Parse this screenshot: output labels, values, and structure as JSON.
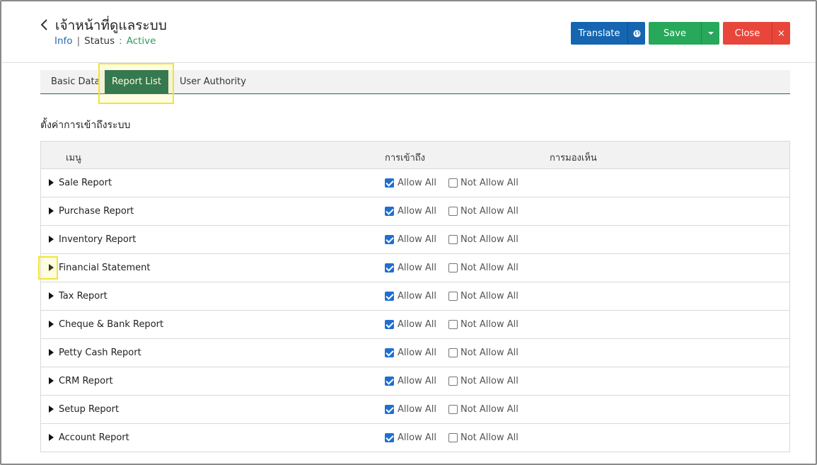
{
  "header": {
    "title": "เจ้าหน้าที่ดูแลระบบ",
    "info_label": "Info",
    "separator": "|",
    "status_label": "Status",
    "colon": ":",
    "status_value": "Active"
  },
  "toolbar": {
    "translate_label": "Translate",
    "save_label": "Save",
    "close_label": "Close",
    "close_x": "×",
    "globe_icon": "globe-icon",
    "caret_icon": "chevron-down-icon"
  },
  "tabs": [
    {
      "label": "Basic Data",
      "active": false
    },
    {
      "label": "Report List",
      "active": true
    },
    {
      "label": "User Authority",
      "active": false
    }
  ],
  "section_title": "ตั้งค่าการเข้าถึงระบบ",
  "table": {
    "columns": [
      "เมนู",
      "การเข้าถึง",
      "การมองเห็น"
    ],
    "allow_label": "Allow All",
    "not_allow_label": "Not Allow All",
    "rows": [
      {
        "label": "Sale Report",
        "allow": true,
        "not_allow": false
      },
      {
        "label": "Purchase Report",
        "allow": true,
        "not_allow": false
      },
      {
        "label": "Inventory Report",
        "allow": true,
        "not_allow": false
      },
      {
        "label": "Financial Statement",
        "allow": true,
        "not_allow": false
      },
      {
        "label": "Tax Report",
        "allow": true,
        "not_allow": false
      },
      {
        "label": "Cheque & Bank Report",
        "allow": true,
        "not_allow": false
      },
      {
        "label": "Petty Cash Report",
        "allow": true,
        "not_allow": false
      },
      {
        "label": "CRM Report",
        "allow": true,
        "not_allow": false
      },
      {
        "label": "Setup Report",
        "allow": true,
        "not_allow": false
      },
      {
        "label": "Account Report",
        "allow": true,
        "not_allow": false
      }
    ]
  },
  "colors": {
    "primary": "#1565b0",
    "success": "#27a85a",
    "danger": "#e8463b",
    "active_tab": "#0a5d4d",
    "highlight": "#f3e23a"
  }
}
